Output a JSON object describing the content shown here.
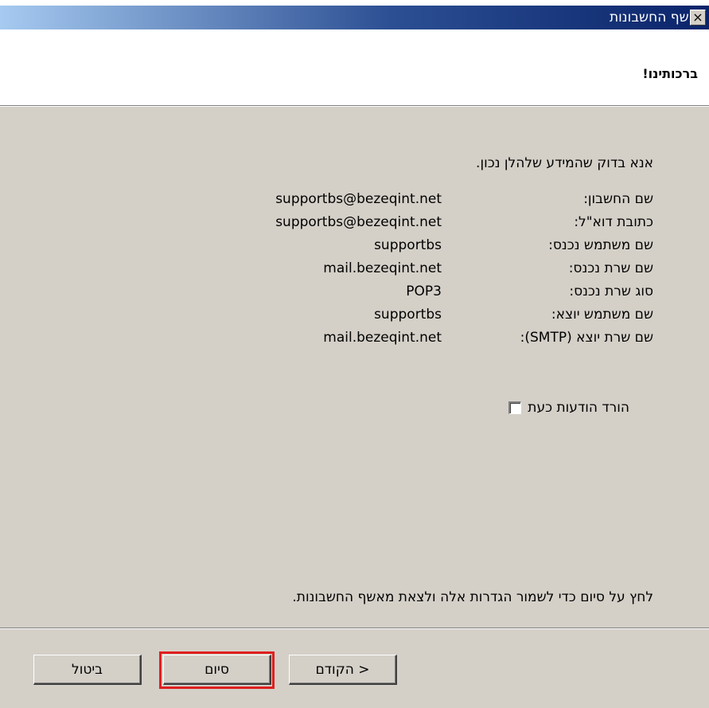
{
  "window": {
    "title": "אשף החשבונות",
    "close_label": "×"
  },
  "header": {
    "title": "ברכותינו!"
  },
  "body": {
    "intro": "אנא בדוק שהמידע שלהלן נכון.",
    "rows": [
      {
        "label": "שם החשבון:",
        "value": "supportbs@bezeqint.net"
      },
      {
        "label": "כתובת דוא\"ל:",
        "value": "supportbs@bezeqint.net"
      },
      {
        "label": "שם משתמש נכנס:",
        "value": "supportbs"
      },
      {
        "label": "שם שרת נכנס:",
        "value": "mail.bezeqint.net"
      },
      {
        "label": "סוג שרת נכנס:",
        "value": "POP3"
      },
      {
        "label": "שם משתמש יוצא:",
        "value": "supportbs"
      },
      {
        "label": "שם שרת יוצא (SMTP):",
        "value": "mail.bezeqint.net"
      }
    ],
    "download_checkbox_label": "הורד הודעות כעת",
    "download_checked": false,
    "finish_note": "לחץ על סיום כדי לשמור הגדרות אלה ולצאת מאשף החשבונות."
  },
  "buttons": {
    "back": "< הקודם",
    "finish": "סיום",
    "cancel": "ביטול"
  },
  "colors": {
    "title_active": "#0a246a",
    "dialog_face": "#d4d0c8",
    "highlight": "#e01e1e"
  }
}
